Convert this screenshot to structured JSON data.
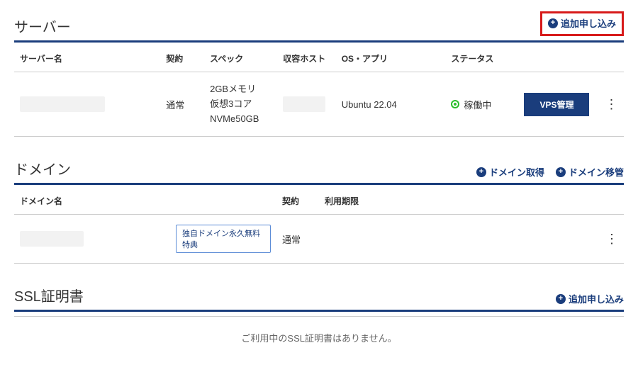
{
  "server": {
    "title": "サーバー",
    "add_label": "追加申し込み",
    "columns": {
      "name": "サーバー名",
      "contract": "契約",
      "spec": "スペック",
      "host": "収容ホスト",
      "os": "OS・アプリ",
      "status": "ステータス"
    },
    "row": {
      "contract": "通常",
      "spec_line1": "2GBメモリ",
      "spec_line2": "仮想3コア",
      "spec_line3": "NVMe50GB",
      "os_app": "Ubuntu 22.04",
      "status_text": "稼働中",
      "manage_btn": "VPS管理"
    }
  },
  "domain": {
    "title": "ドメイン",
    "get_label": "ドメイン取得",
    "transfer_label": "ドメイン移管",
    "columns": {
      "name": "ドメイン名",
      "contract": "契約",
      "expiry": "利用期限"
    },
    "row": {
      "badge": "独自ドメイン永久無料特典",
      "contract": "通常"
    }
  },
  "ssl": {
    "title": "SSL証明書",
    "add_label": "追加申し込み",
    "empty_message": "ご利用中のSSL証明書はありません。"
  }
}
